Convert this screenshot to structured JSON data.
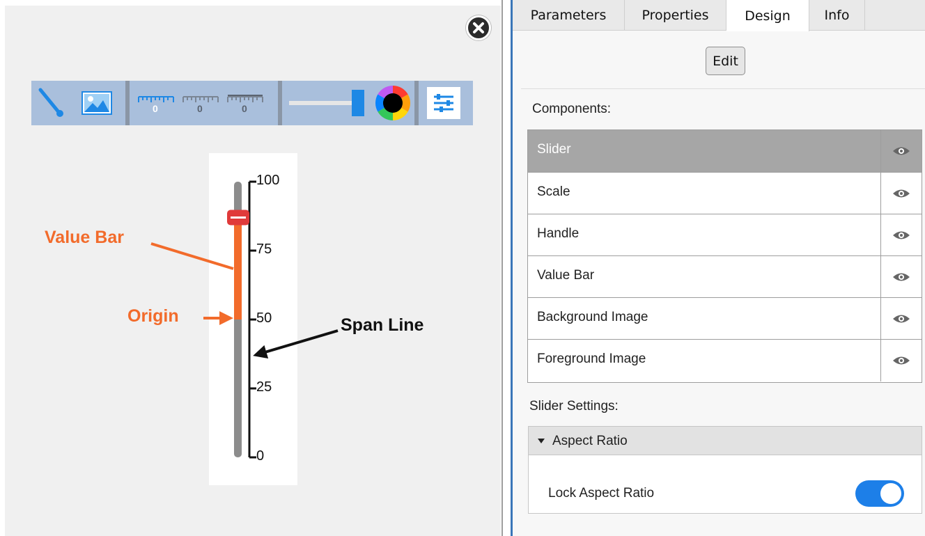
{
  "canvas": {
    "close_icon": "close-circle-icon",
    "toolbar": {
      "items": [
        {
          "icon": "needle-icon"
        },
        {
          "icon": "image-icon"
        },
        {
          "icon": "scale-ruler-icon"
        },
        {
          "icon": "scale-ruler-icon"
        },
        {
          "icon": "scale-ruler-icon"
        },
        {
          "icon": "slider-bar-icon"
        },
        {
          "icon": "color-wheel-icon"
        },
        {
          "icon": "settings-sliders-icon"
        }
      ],
      "ruler_digit": "0"
    },
    "slider": {
      "min": 0,
      "max": 100,
      "ticks": [
        "100",
        "75",
        "50",
        "25",
        "0"
      ],
      "value": 87,
      "origin": 50,
      "value_bar_color": "#f26b2b",
      "handle_color": "#e03a3a",
      "span_color": "#8c8c8c"
    },
    "annotations": {
      "value_bar": "Value Bar",
      "origin": "Origin",
      "span_line": "Span Line"
    },
    "colors": {
      "annotation_orange": "#f26b2b",
      "toolbar_bg": "#a9bfdc",
      "toolbar_blue": "#1e88e5"
    }
  },
  "panel": {
    "tabs": [
      {
        "label": "Parameters",
        "active": false
      },
      {
        "label": "Properties",
        "active": false
      },
      {
        "label": "Design",
        "active": true
      },
      {
        "label": "Info",
        "active": false
      }
    ],
    "edit_label": "Edit",
    "components_label": "Components:",
    "components": [
      {
        "name": "Slider",
        "selected": true
      },
      {
        "name": "Scale",
        "selected": false
      },
      {
        "name": "Handle",
        "selected": false
      },
      {
        "name": "Value Bar",
        "selected": false
      },
      {
        "name": "Background Image",
        "selected": false
      },
      {
        "name": "Foreground Image",
        "selected": false
      }
    ],
    "eye_icon": "eye-icon",
    "settings_label": "Slider Settings:",
    "aspect_section": {
      "title": "Aspect Ratio",
      "lock_label": "Lock Aspect Ratio",
      "lock_enabled": true
    },
    "accent": "#1d7fe8"
  }
}
